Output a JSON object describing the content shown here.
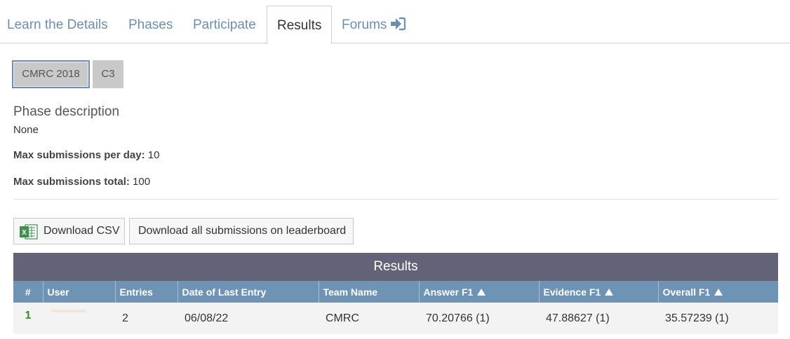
{
  "tabs": [
    {
      "label": "Learn the Details"
    },
    {
      "label": "Phases"
    },
    {
      "label": "Participate"
    },
    {
      "label": "Results"
    },
    {
      "label": "Forums"
    }
  ],
  "active_tab": "Results",
  "phases": [
    {
      "label": "CMRC 2018",
      "selected": true
    },
    {
      "label": "C3",
      "selected": false
    }
  ],
  "phase_info": {
    "title": "Phase description",
    "description": "None",
    "max_per_day_label": "Max submissions per day:",
    "max_per_day_value": "10",
    "max_total_label": "Max submissions total:",
    "max_total_value": "100"
  },
  "buttons": {
    "download_csv": "Download CSV",
    "download_all": "Download all submissions on leaderboard"
  },
  "results": {
    "title": "Results",
    "columns": [
      "#",
      "User",
      "Entries",
      "Date of Last Entry",
      "Team Name",
      "Answer F1",
      "Evidence F1",
      "Overall F1"
    ],
    "rows": [
      {
        "rank": "1",
        "user": "",
        "entries": "2",
        "date": "06/08/22",
        "team": "CMRC",
        "answer_f1": "70.20766 (1)",
        "evidence_f1": "47.88627 (1)",
        "overall_f1": "35.57239 (1)"
      }
    ]
  },
  "colors": {
    "tab_link": "#6c8fb0",
    "results_header": "#636377",
    "table_header": "#6f93b4",
    "rank": "#3a8a2a"
  }
}
